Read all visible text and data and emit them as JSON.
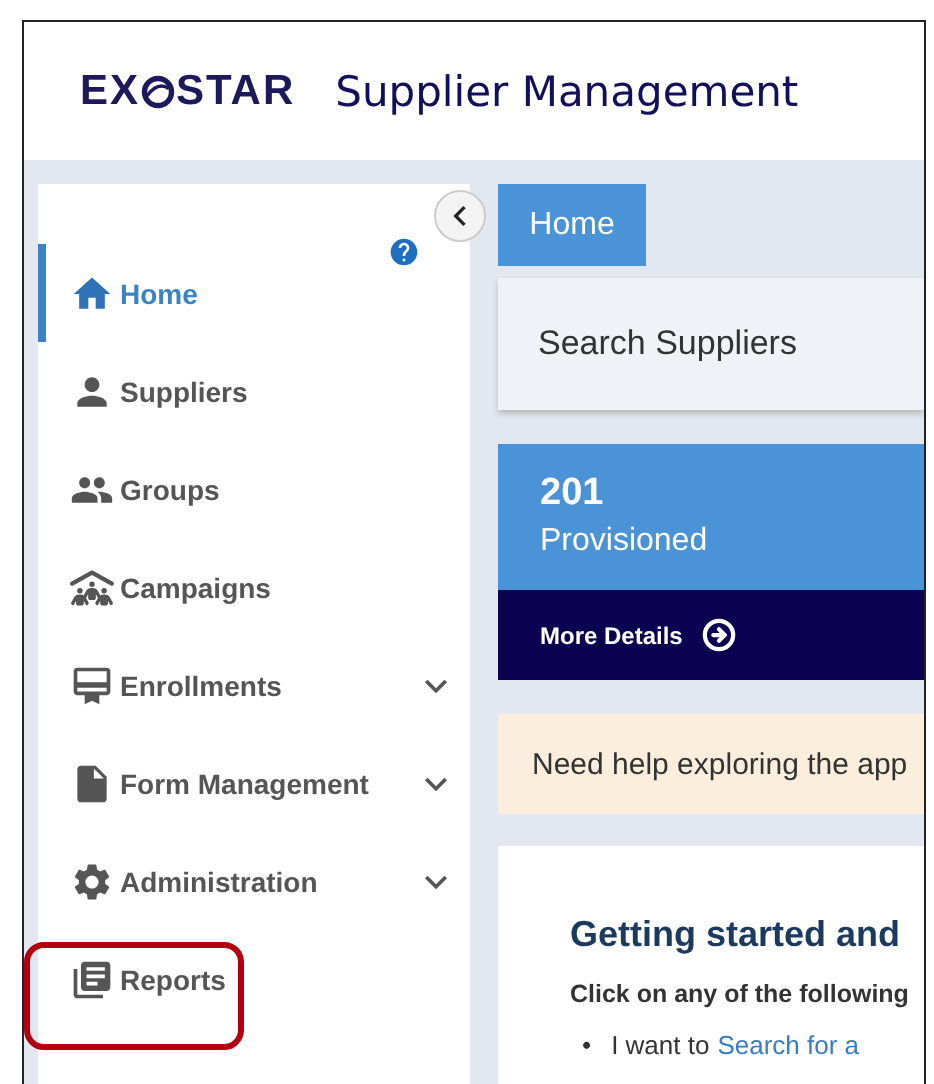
{
  "header": {
    "logo_start": "EX",
    "logo_end": "STAR",
    "title": "Supplier Management"
  },
  "sidebar": {
    "items": [
      {
        "label": "Home",
        "kind": "link",
        "selected": true,
        "highlighted": false
      },
      {
        "label": "Suppliers",
        "kind": "link",
        "selected": false,
        "highlighted": false
      },
      {
        "label": "Groups",
        "kind": "link",
        "selected": false,
        "highlighted": false
      },
      {
        "label": "Campaigns",
        "kind": "link",
        "selected": false,
        "highlighted": false
      },
      {
        "label": "Enrollments",
        "kind": "group",
        "selected": false,
        "highlighted": false
      },
      {
        "label": "Form Management",
        "kind": "group",
        "selected": false,
        "highlighted": false
      },
      {
        "label": "Administration",
        "kind": "group",
        "selected": false,
        "highlighted": false
      },
      {
        "label": "Reports",
        "kind": "link",
        "selected": false,
        "highlighted": true
      }
    ]
  },
  "breadcrumb": {
    "label": "Home"
  },
  "search_card": {
    "title": "Search Suppliers"
  },
  "stat_card": {
    "count": "201",
    "label": "Provisioned",
    "link": "More Details"
  },
  "help_banner": {
    "text": "Need help exploring the app"
  },
  "getting_started": {
    "title": "Getting started and",
    "intro": "Click on any of the following",
    "bullets": [
      {
        "marker": "•",
        "text": "I want to",
        "link": "Search for a"
      }
    ]
  }
}
